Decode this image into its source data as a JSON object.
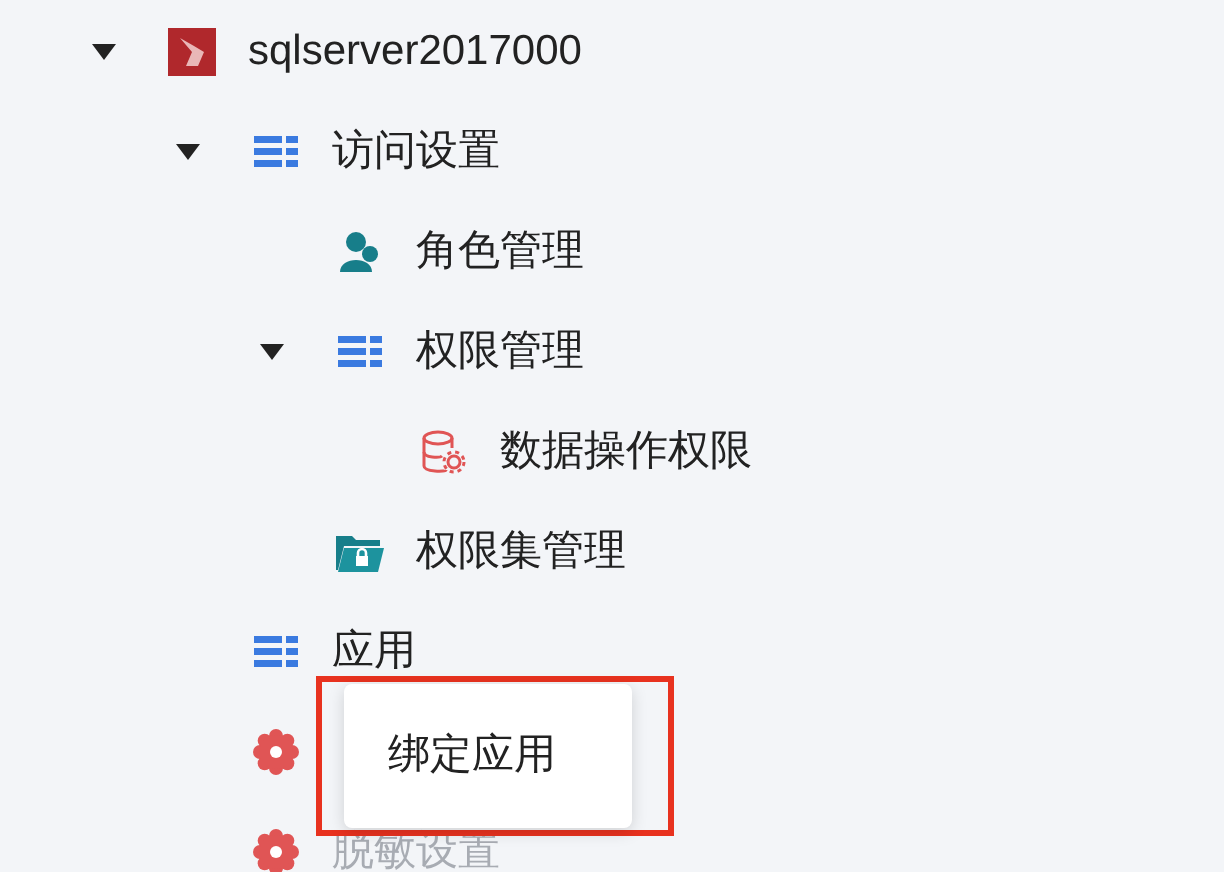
{
  "tree": [
    {
      "label": "sqlserver2017000",
      "kind": "database",
      "expanded": true,
      "children": [
        {
          "label": "访问设置",
          "kind": "group",
          "expanded": true,
          "children": [
            {
              "label": "角色管理",
              "kind": "roles"
            },
            {
              "label": "权限管理",
              "kind": "group",
              "expanded": true,
              "children": [
                {
                  "label": "数据操作权限",
                  "kind": "data-permission"
                }
              ]
            },
            {
              "label": "权限集管理",
              "kind": "permission-set"
            }
          ]
        },
        {
          "label": "应用",
          "kind": "group"
        },
        {
          "kind": "setting"
        },
        {
          "label": "脱敏设置",
          "kind": "setting",
          "disabled": true
        }
      ]
    }
  ],
  "context_menu": {
    "items": [
      {
        "label": "绑定应用"
      }
    ]
  }
}
